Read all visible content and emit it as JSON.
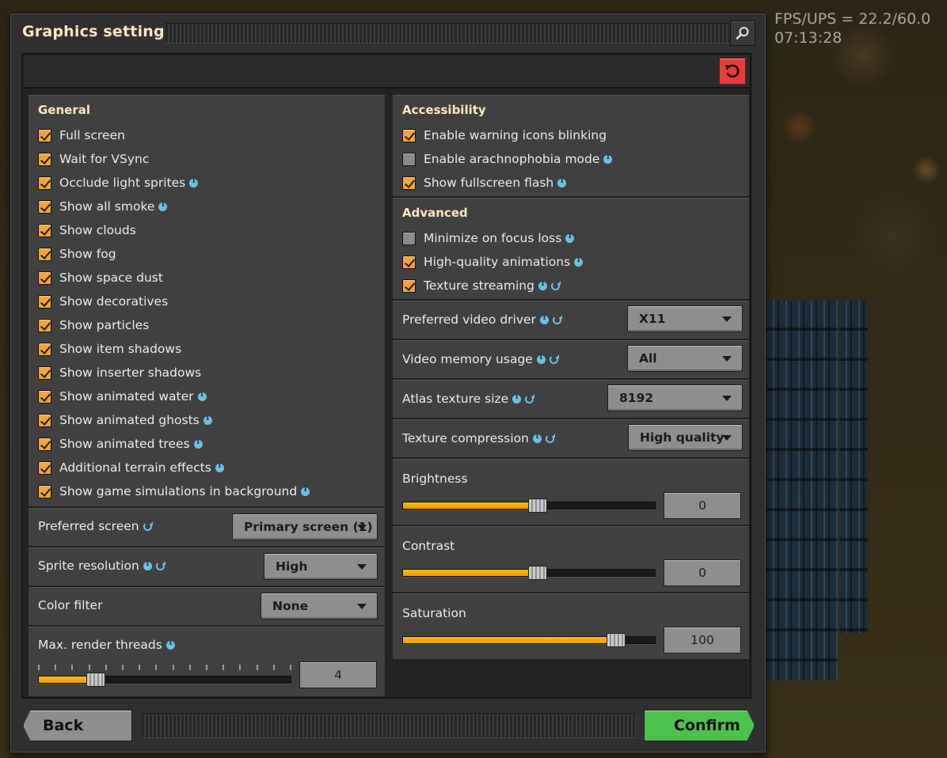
{
  "hud": {
    "fps_ups": "FPS/UPS = 22.2/60.0",
    "clock": "07:13:28"
  },
  "window": {
    "title": "Graphics settings"
  },
  "general": {
    "title": "General",
    "items": [
      {
        "label": "Full screen",
        "checked": true,
        "info": false
      },
      {
        "label": "Wait for VSync",
        "checked": true,
        "info": false
      },
      {
        "label": "Occlude light sprites",
        "checked": true,
        "info": true
      },
      {
        "label": "Show all smoke",
        "checked": true,
        "info": true
      },
      {
        "label": "Show clouds",
        "checked": true,
        "info": false
      },
      {
        "label": "Show fog",
        "checked": true,
        "info": false
      },
      {
        "label": "Show space dust",
        "checked": true,
        "info": false
      },
      {
        "label": "Show decoratives",
        "checked": true,
        "info": false
      },
      {
        "label": "Show particles",
        "checked": true,
        "info": false
      },
      {
        "label": "Show item shadows",
        "checked": true,
        "info": false
      },
      {
        "label": "Show inserter shadows",
        "checked": true,
        "info": false
      },
      {
        "label": "Show animated water",
        "checked": true,
        "info": true
      },
      {
        "label": "Show animated ghosts",
        "checked": true,
        "info": true
      },
      {
        "label": "Show animated trees",
        "checked": true,
        "info": true
      },
      {
        "label": "Additional terrain effects",
        "checked": true,
        "info": true
      },
      {
        "label": "Show game simulations in background",
        "checked": true,
        "info": true
      }
    ]
  },
  "preferred_screen": {
    "label": "Preferred screen",
    "value": "Primary screen (1)"
  },
  "sprite_resolution": {
    "label": "Sprite resolution",
    "value": "High"
  },
  "color_filter": {
    "label": "Color filter",
    "value": "None"
  },
  "render_threads": {
    "label": "Max. render threads",
    "value": "4",
    "level": 4,
    "max": 16
  },
  "accessibility": {
    "title": "Accessibility",
    "items": [
      {
        "label": "Enable warning icons blinking",
        "checked": true,
        "info": false,
        "restart": false
      },
      {
        "label": "Enable arachnophobia mode",
        "checked": false,
        "info": true,
        "restart": false
      },
      {
        "label": "Show fullscreen flash",
        "checked": true,
        "info": true,
        "restart": false
      }
    ]
  },
  "advanced": {
    "title": "Advanced",
    "items": [
      {
        "label": "Minimize on focus loss",
        "checked": false,
        "info": true,
        "restart": false
      },
      {
        "label": "High-quality animations",
        "checked": true,
        "info": true,
        "restart": false
      },
      {
        "label": "Texture streaming",
        "checked": true,
        "info": true,
        "restart": true
      }
    ]
  },
  "video_driver": {
    "label": "Preferred video driver",
    "value": "X11"
  },
  "video_memory": {
    "label": "Video memory usage",
    "value": "All"
  },
  "atlas_size": {
    "label": "Atlas texture size",
    "value": "8192"
  },
  "texture_compression": {
    "label": "Texture compression",
    "value": "High quality"
  },
  "brightness": {
    "label": "Brightness",
    "value": "0",
    "fraction": 0.5
  },
  "contrast": {
    "label": "Contrast",
    "value": "0",
    "fraction": 0.5
  },
  "saturation": {
    "label": "Saturation",
    "value": "100",
    "fraction": 0.81
  },
  "buttons": {
    "back": "Back",
    "confirm": "Confirm"
  },
  "colors": {
    "accent": "#f1a43a",
    "confirm": "#4dc14d",
    "reset": "#e33d3d",
    "title": "#ffe6c0"
  }
}
